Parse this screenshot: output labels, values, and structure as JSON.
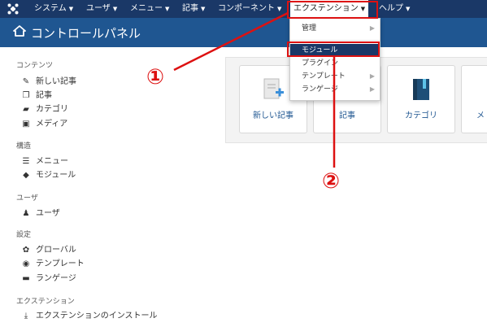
{
  "topbar": {
    "logo": "joomla-logo-icon",
    "menus": [
      {
        "label": "システム"
      },
      {
        "label": "ユーザ"
      },
      {
        "label": "メニュー"
      },
      {
        "label": "記事"
      },
      {
        "label": "コンポーネント"
      },
      {
        "label": "エクステンション",
        "active": true
      },
      {
        "label": "ヘルプ"
      }
    ]
  },
  "titlebar": {
    "icon": "home-icon",
    "title": "コントロールパネル"
  },
  "sidebar": {
    "sections": [
      {
        "heading": "コンテンツ",
        "items": [
          {
            "label": "新しい記事",
            "icon": "pencil-icon"
          },
          {
            "label": "記事",
            "icon": "copy-icon"
          },
          {
            "label": "カテゴリ",
            "icon": "folder-icon"
          },
          {
            "label": "メディア",
            "icon": "image-icon"
          }
        ]
      },
      {
        "heading": "構造",
        "items": [
          {
            "label": "メニュー",
            "icon": "list-icon"
          },
          {
            "label": "モジュール",
            "icon": "cube-icon"
          }
        ]
      },
      {
        "heading": "ユーザ",
        "items": [
          {
            "label": "ユーザ",
            "icon": "user-icon"
          }
        ]
      },
      {
        "heading": "設定",
        "items": [
          {
            "label": "グローバル",
            "icon": "cog-icon"
          },
          {
            "label": "テンプレート",
            "icon": "eye-icon"
          },
          {
            "label": "ランゲージ",
            "icon": "comments-icon"
          }
        ]
      },
      {
        "heading": "エクステンション",
        "items": [
          {
            "label": "エクステンションのインストール",
            "icon": "download-icon"
          }
        ]
      }
    ]
  },
  "quickicons": [
    {
      "label": "新しい記事",
      "icon": "new-article-icon"
    },
    {
      "label": "記事",
      "icon": "articles-icon"
    },
    {
      "label": "カテゴリ",
      "icon": "categories-icon"
    },
    {
      "label": "メ",
      "icon": "media-icon"
    }
  ],
  "dropdown": {
    "items": [
      {
        "label": "管理",
        "submenu": true
      },
      {
        "label": "モジュール",
        "highlighted": true
      },
      {
        "label": "プラグイン",
        "submenu": false
      },
      {
        "label": "テンプレート",
        "submenu": true
      },
      {
        "label": "ランゲージ",
        "submenu": true
      }
    ]
  },
  "annotations": {
    "callout1": "①",
    "callout2": "②",
    "color": "#dd1111"
  },
  "colors": {
    "topbar": "#1a3867",
    "titlebar": "#1f5691",
    "accent": "#dd1111"
  }
}
